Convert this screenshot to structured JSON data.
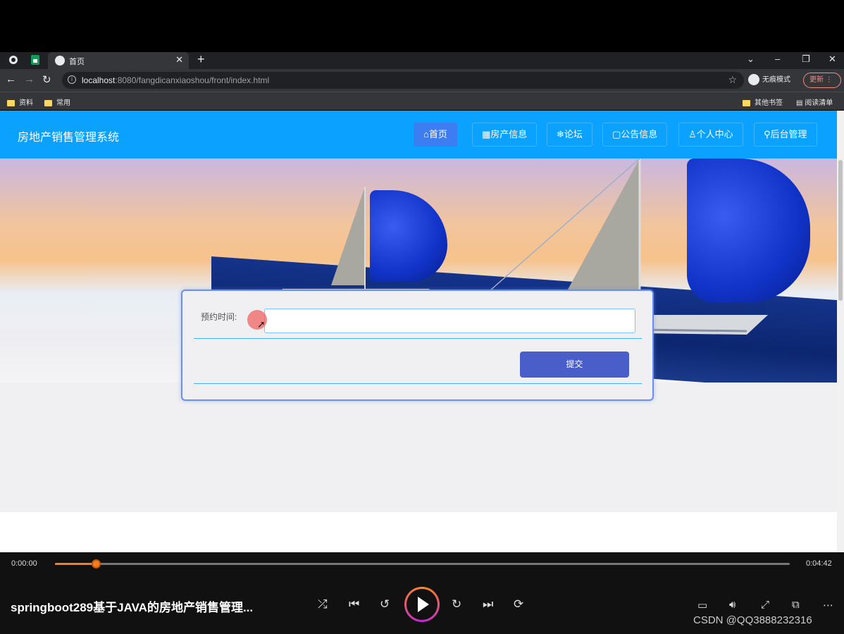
{
  "browser": {
    "tab_title": "首页",
    "tab_close": "✕",
    "new_tab": "+",
    "url_host": "localhost",
    "url_rest": ":8080/fangdicanxiaoshou/front/index.html",
    "incognito_label": "无痕模式",
    "update_label": "更新",
    "bookmarks": [
      "资料",
      "常用"
    ],
    "other_bookmarks": "其他书签",
    "reading_list": "阅读清单"
  },
  "site": {
    "name": "房地产销售管理系统",
    "nav": [
      {
        "icon": "⌂",
        "label": "首页"
      },
      {
        "icon": "▦",
        "label": "房产信息"
      },
      {
        "icon": "❄",
        "label": "论坛"
      },
      {
        "icon": "▢",
        "label": "公告信息"
      },
      {
        "icon": "♙",
        "label": "个人中心"
      },
      {
        "icon": "⚲",
        "label": "后台管理"
      }
    ],
    "carousel_active_index": 0
  },
  "form": {
    "label": "预约时间:",
    "input_value": "",
    "submit_label": "提交"
  },
  "player": {
    "current_time": "0:00:00",
    "total_time": "0:04:42",
    "progress_fraction": 0.056,
    "title": "springboot289基于JAVA的房地产销售管理...",
    "watermark": "CSDN @QQ3888232316"
  }
}
